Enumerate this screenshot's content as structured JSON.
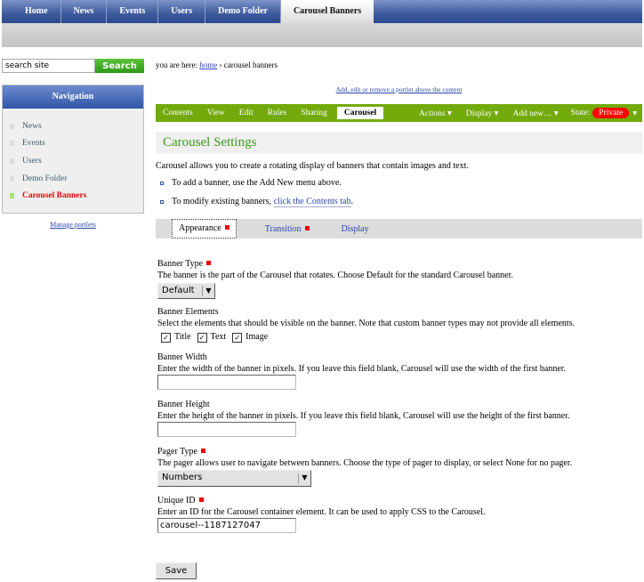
{
  "topnav": [
    "Home",
    "News",
    "Events",
    "Users",
    "Demo Folder",
    "Carousel Banners"
  ],
  "search": {
    "value": "search site",
    "button": "Search"
  },
  "navigation": {
    "title": "Navigation",
    "items": [
      "News",
      "Events",
      "Users",
      "Demo Folder",
      "Carousel Banners"
    ],
    "current": "Carousel Banners"
  },
  "manage_portlets": "Manage portlets",
  "breadcrumb": {
    "prefix": "you are here: ",
    "home": "home",
    "sep": " › ",
    "current": "carousel banners"
  },
  "add_portlet": "Add, edit or remove a portlet above the content",
  "toolbar": {
    "left": [
      "Contents",
      "View",
      "Edit",
      "Rules",
      "Sharing",
      "Carousel"
    ],
    "active": "Carousel",
    "actions": "Actions ▾",
    "display": "Display ▾",
    "add_new": "Add new… ▾",
    "state_label": "State:",
    "state": "Private",
    "state_arrow": "▾"
  },
  "colors": {
    "toolbar": "#72aa0c",
    "heading": "#3b9b19",
    "state": "#ff0000",
    "nav_blue": "#3d5a9c"
  },
  "heading": "Carousel Settings",
  "intro": "Carousel allows you to create a rotating display of banners that contain images and text.",
  "bullets": {
    "b1": "To add a banner, use the Add New menu above.",
    "b2_prefix": "To modify existing banners, ",
    "b2_link": "click the Contents tab",
    "b2_suffix": "."
  },
  "tabs": [
    "Appearance",
    "Transition",
    "Display"
  ],
  "form": {
    "banner_type": {
      "label": "Banner Type",
      "desc": "The banner is the part of the Carousel that rotates. Choose Default for the standard Carousel banner.",
      "value": "Default"
    },
    "banner_elements": {
      "label": "Banner Elements",
      "desc": "Select the elements that should be visible on the banner. Note that custom banner types may not provide all elements.",
      "options": [
        "Title",
        "Text",
        "Image"
      ],
      "checked": [
        true,
        true,
        true
      ]
    },
    "banner_width": {
      "label": "Banner Width",
      "desc": "Enter the width of the banner in pixels. If you leave this field blank, Carousel will use the width of the first banner.",
      "value": ""
    },
    "banner_height": {
      "label": "Banner Height",
      "desc": "Enter the height of the banner in pixels. If you leave this field blank, Carousel will use the height of the first banner.",
      "value": ""
    },
    "pager_type": {
      "label": "Pager Type",
      "desc": "The pager allows user to navigate between banners. Choose the type of pager to display, or select None for no pager.",
      "value": "Numbers"
    },
    "unique_id": {
      "label": "Unique ID",
      "desc": "Enter an ID for the Carousel container element. It can be used to apply CSS to the Carousel.",
      "value": "carousel--1187127047"
    },
    "save": "Save"
  }
}
